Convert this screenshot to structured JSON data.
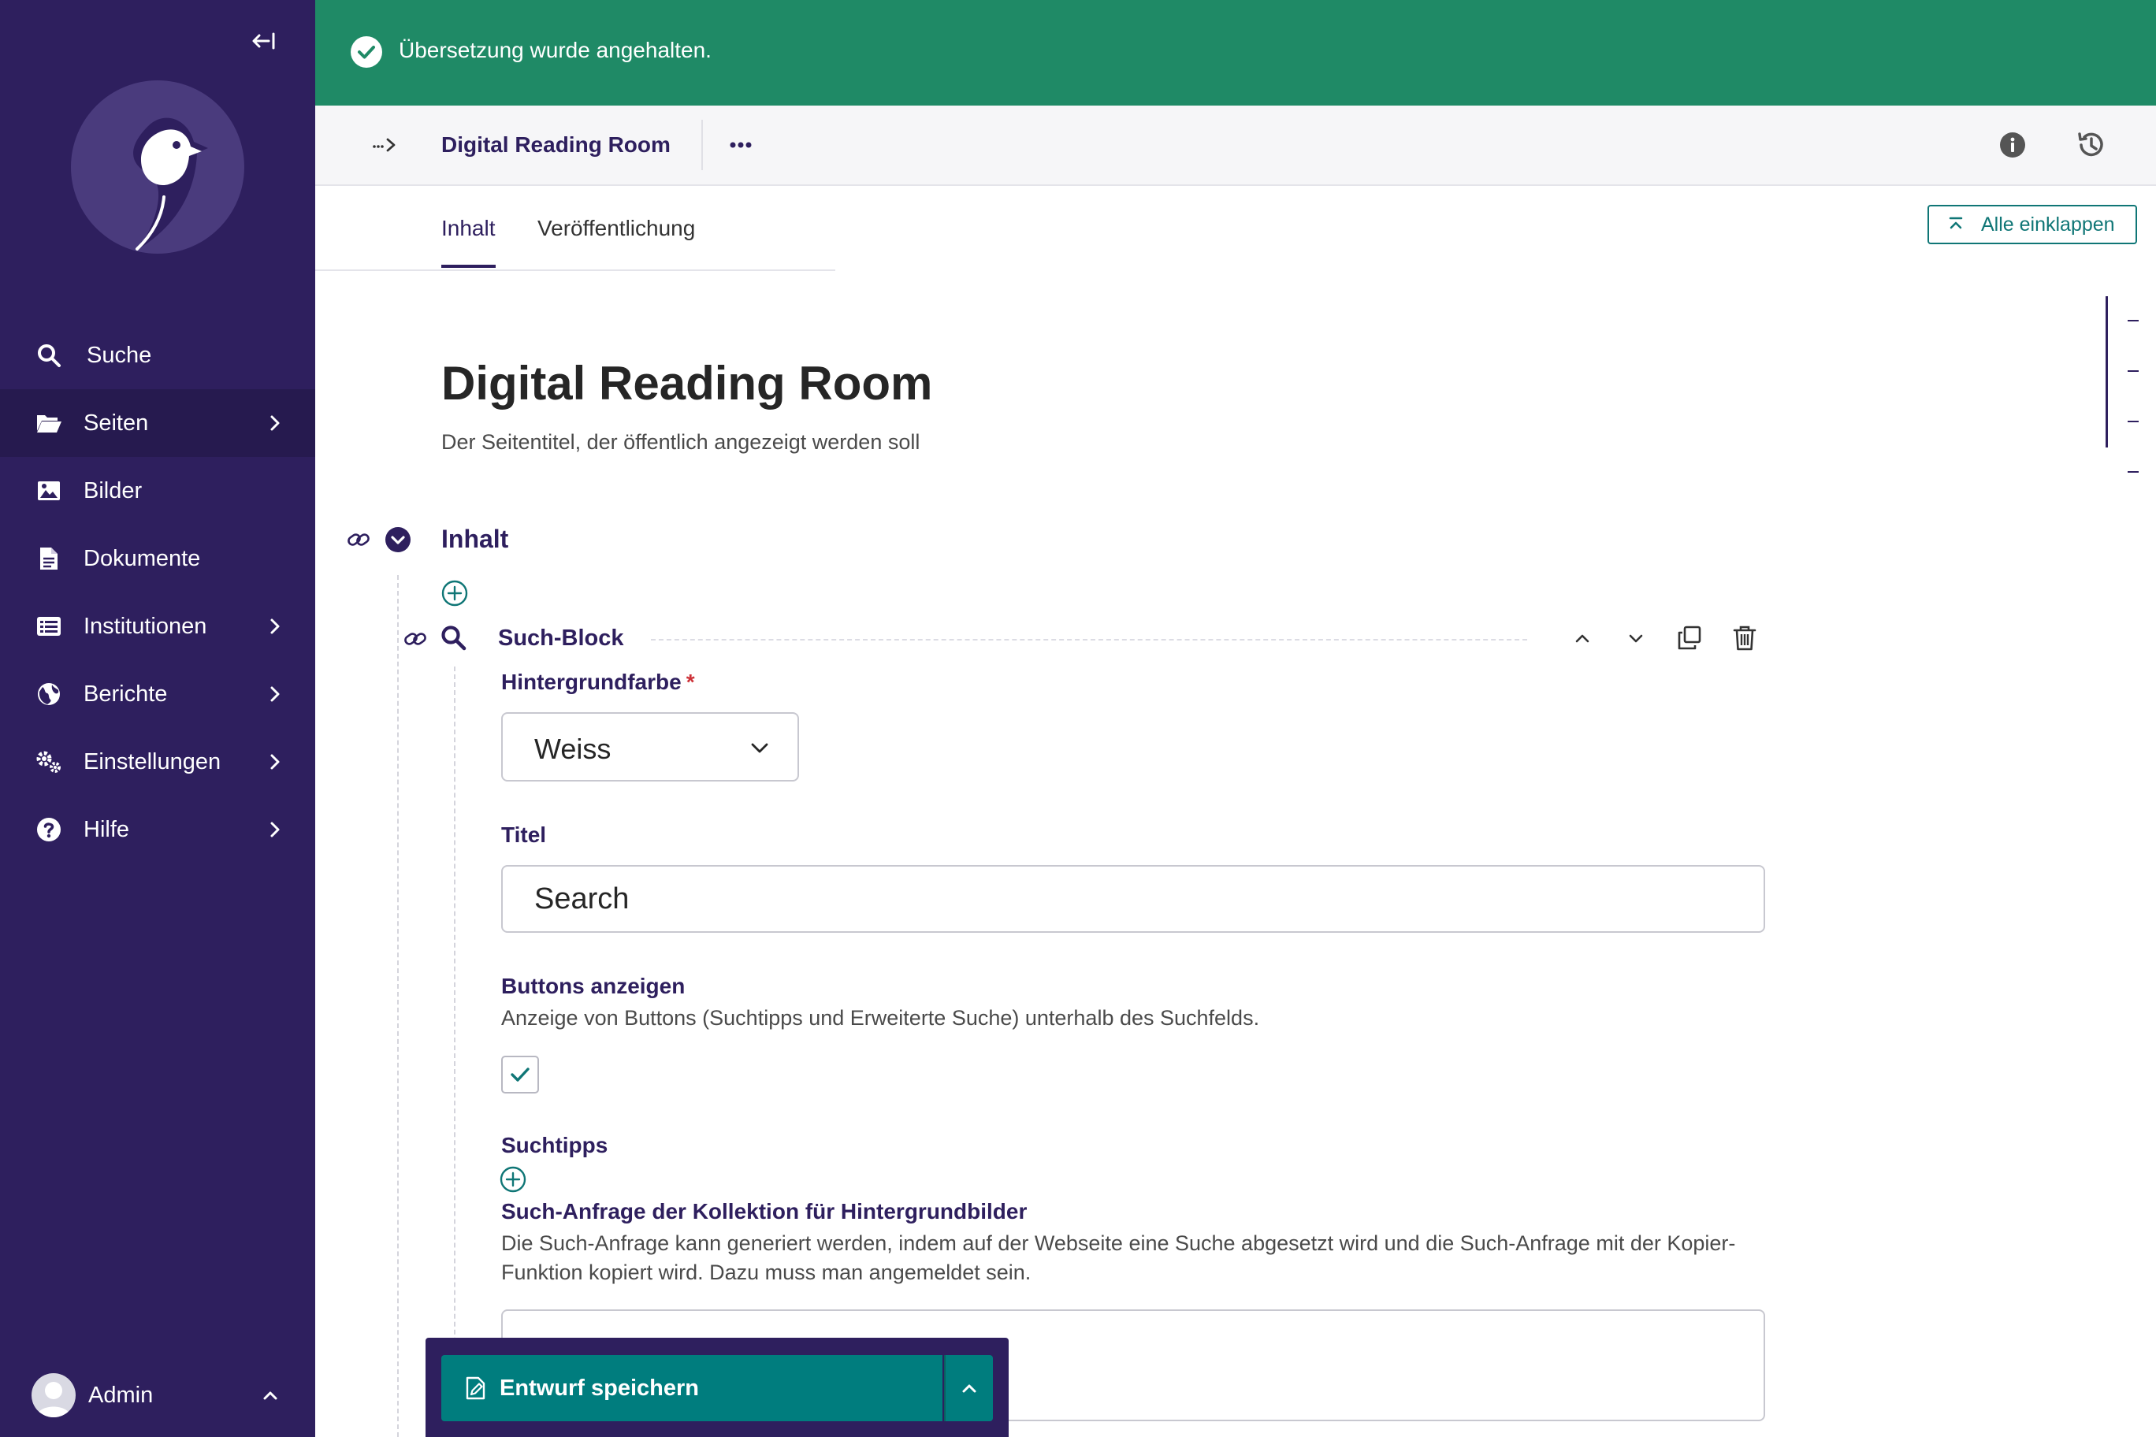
{
  "app": {
    "name": "Wagtail Admin"
  },
  "colors": {
    "sidebar": "#2e1f5e",
    "success": "#1f8a66",
    "teal": "#007d7e",
    "accent": "#2e1f5e",
    "required": "#cd3238"
  },
  "banner": {
    "message": "Übersetzung wurde angehalten.",
    "icon": "check-circle-icon"
  },
  "sidebar": {
    "items": [
      {
        "label": "Suche",
        "icon": "search-icon",
        "has_submenu": false
      },
      {
        "label": "Seiten",
        "icon": "folder-open-icon",
        "has_submenu": true,
        "active": true
      },
      {
        "label": "Bilder",
        "icon": "image-icon",
        "has_submenu": false
      },
      {
        "label": "Dokumente",
        "icon": "document-icon",
        "has_submenu": false
      },
      {
        "label": "Institutionen",
        "icon": "list-icon",
        "has_submenu": true
      },
      {
        "label": "Berichte",
        "icon": "globe-icon",
        "has_submenu": true
      },
      {
        "label": "Einstellungen",
        "icon": "cogs-icon",
        "has_submenu": true
      },
      {
        "label": "Hilfe",
        "icon": "help-icon",
        "has_submenu": true
      }
    ],
    "account": {
      "name": "Admin"
    }
  },
  "header": {
    "title": "Digital Reading Room"
  },
  "tabs": [
    {
      "label": "Inhalt",
      "active": true
    },
    {
      "label": "Veröffentlichung",
      "active": false
    }
  ],
  "collapse_all_label": "Alle einklappen",
  "page": {
    "title": "Digital Reading Room",
    "title_help": "Der Seitentitel, der öffentlich angezeigt werden soll"
  },
  "section": {
    "heading": "Inhalt"
  },
  "block": {
    "title": "Such-Block",
    "fields": {
      "background": {
        "label": "Hintergrundfarbe",
        "required_mark": "*",
        "value": "Weiss"
      },
      "title": {
        "label": "Titel",
        "value": "Search"
      },
      "buttons": {
        "label": "Buttons anzeigen",
        "help": "Anzeige von Buttons (Suchtipps und Erweiterte Suche) unterhalb des Suchfelds.",
        "checked": true
      },
      "tips": {
        "label": "Suchtipps"
      },
      "query": {
        "label": "Such-Anfrage der Kollektion für Hintergrundbilder",
        "help": "Die Such-Anfrage kann generiert werden, indem auf der Webseite eine Suche abgesetzt wird und die Such-Anfrage mit der Kopier-Funktion kopiert wird. Dazu muss man angemeldet sein.",
        "value": ""
      }
    }
  },
  "footer": {
    "save_label": "Entwurf speichern"
  }
}
